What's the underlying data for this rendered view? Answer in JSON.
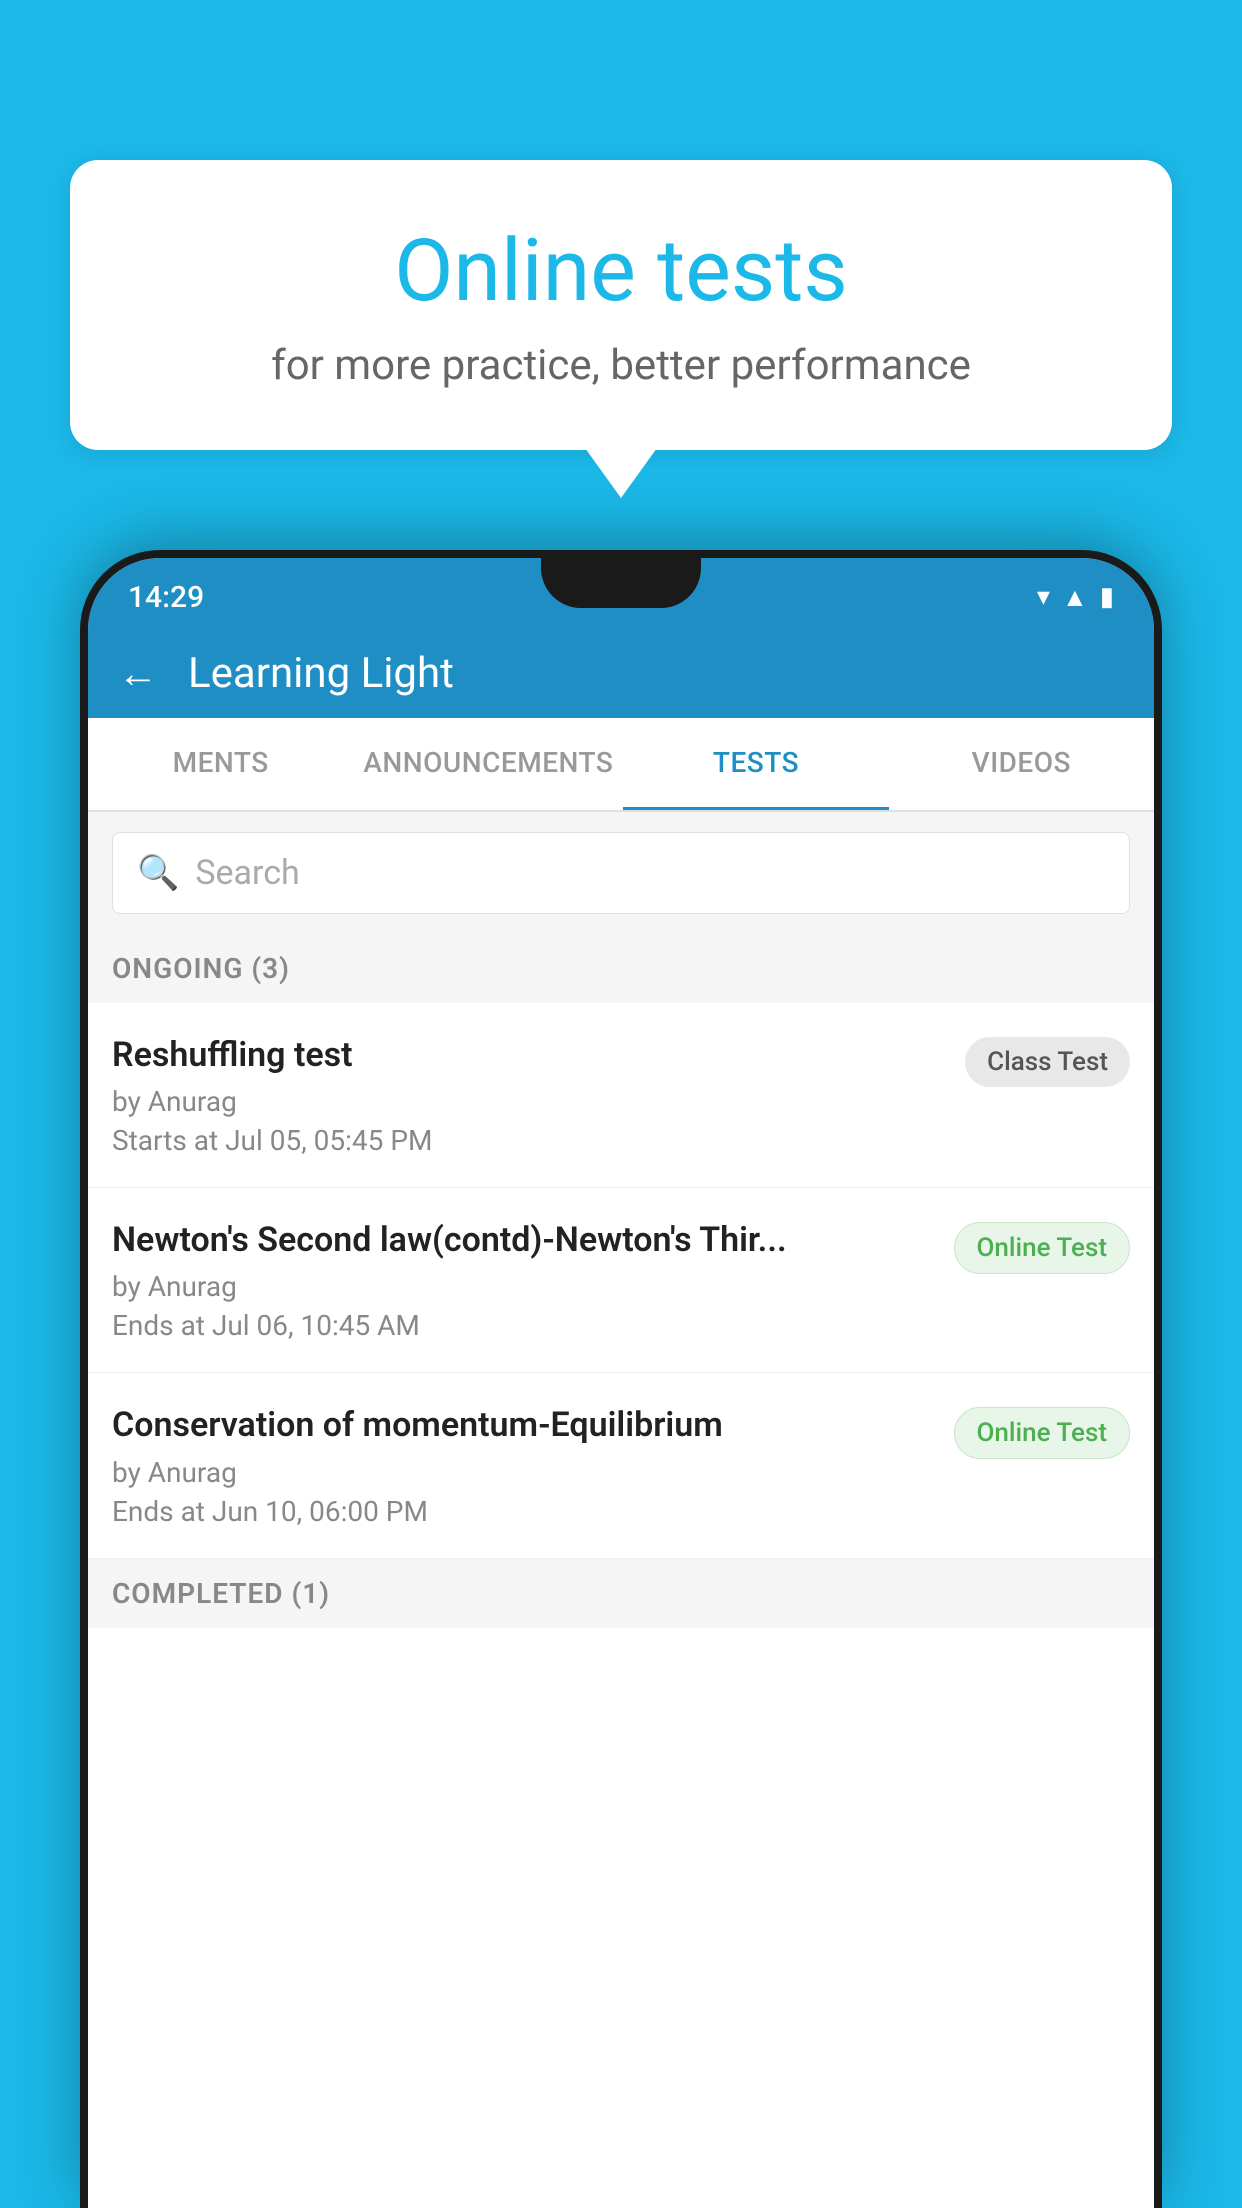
{
  "background_color": "#1bb8e8",
  "speech_bubble": {
    "title": "Online tests",
    "subtitle": "for more practice, better performance"
  },
  "status_bar": {
    "time": "14:29",
    "icons": [
      "wifi",
      "signal",
      "battery"
    ]
  },
  "app_header": {
    "title": "Learning Light",
    "back_label": "←"
  },
  "tabs": [
    {
      "label": "MENTS",
      "active": false
    },
    {
      "label": "ANNOUNCEMENTS",
      "active": false
    },
    {
      "label": "TESTS",
      "active": true
    },
    {
      "label": "VIDEOS",
      "active": false
    }
  ],
  "search": {
    "placeholder": "Search"
  },
  "ongoing_section": {
    "label": "ONGOING (3)"
  },
  "tests": [
    {
      "name": "Reshuffling test",
      "by": "by Anurag",
      "date": "Starts at  Jul 05, 05:45 PM",
      "badge": "Class Test",
      "badge_type": "class"
    },
    {
      "name": "Newton's Second law(contd)-Newton's Thir...",
      "by": "by Anurag",
      "date": "Ends at  Jul 06, 10:45 AM",
      "badge": "Online Test",
      "badge_type": "online"
    },
    {
      "name": "Conservation of momentum-Equilibrium",
      "by": "by Anurag",
      "date": "Ends at  Jun 10, 06:00 PM",
      "badge": "Online Test",
      "badge_type": "online"
    }
  ],
  "completed_section": {
    "label": "COMPLETED (1)"
  }
}
